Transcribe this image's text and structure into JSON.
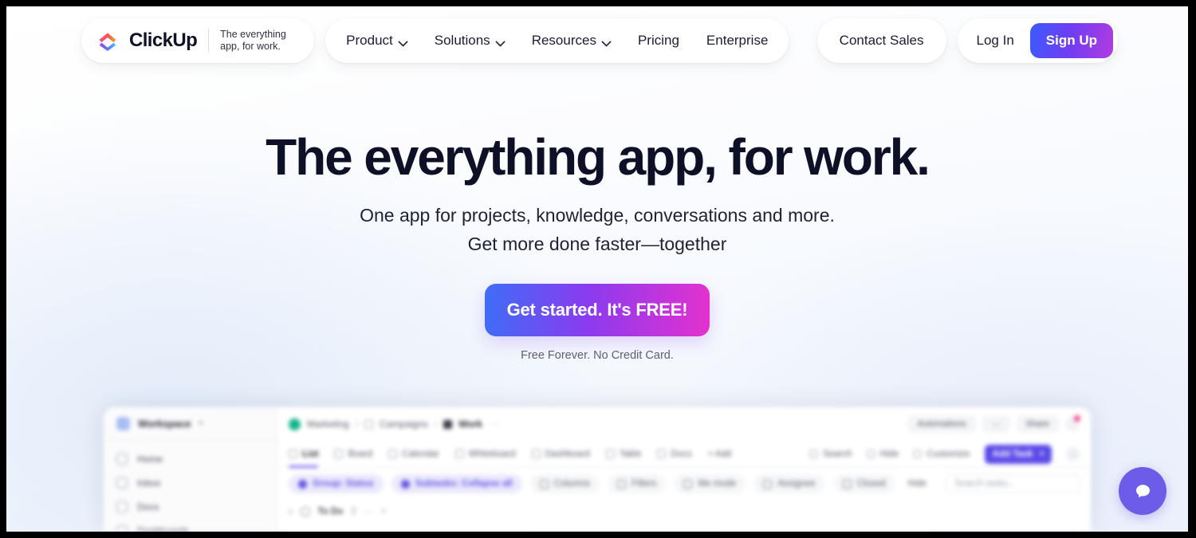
{
  "nav": {
    "logo": {
      "word": "ClickUp",
      "tagline": "The everything app, for work.",
      "icon": "clickup-logo-icon"
    },
    "items": [
      {
        "label": "Product",
        "has_chevron": true
      },
      {
        "label": "Solutions",
        "has_chevron": true
      },
      {
        "label": "Resources",
        "has_chevron": true
      },
      {
        "label": "Pricing",
        "has_chevron": false
      },
      {
        "label": "Enterprise",
        "has_chevron": false
      }
    ],
    "contact_sales": "Contact Sales",
    "log_in": "Log In",
    "sign_up": "Sign Up"
  },
  "hero": {
    "headline": "The everything app, for work.",
    "sub_line1": "One app for projects, knowledge, conversations and more.",
    "sub_line2": "Get more done faster—together",
    "cta_label": "Get started. It's FREE!",
    "cta_note": "Free Forever. No Credit Card."
  },
  "app_preview": {
    "workspace": {
      "name": "Workspace",
      "caret": "▾"
    },
    "sidebar_items": [
      {
        "label": "Home",
        "icon": "home-icon"
      },
      {
        "label": "Inbox",
        "icon": "inbox-icon"
      },
      {
        "label": "Docs",
        "icon": "docs-icon"
      },
      {
        "label": "Dashboards",
        "icon": "dashboards-icon"
      }
    ],
    "breadcrumb": {
      "space": "Marketing",
      "folder": "Campaigns",
      "list": "Work",
      "separator": "/",
      "more": "⋯"
    },
    "header_actions": [
      {
        "label": "Automations"
      },
      {
        "label": "⋯"
      },
      {
        "label": "Share"
      }
    ],
    "views": [
      {
        "label": "List",
        "active": true
      },
      {
        "label": "Board",
        "active": false
      },
      {
        "label": "Calendar",
        "active": false
      },
      {
        "label": "Whiteboard",
        "active": false
      },
      {
        "label": "Dashboard",
        "active": false
      },
      {
        "label": "Table",
        "active": false
      },
      {
        "label": "Docs",
        "active": false
      },
      {
        "label": "+ Add",
        "active": false
      }
    ],
    "view_tools": [
      {
        "label": "Search",
        "icon": "search-icon"
      },
      {
        "label": "Hide",
        "icon": "eye-off-icon"
      },
      {
        "label": "Customize",
        "icon": "sliders-icon"
      }
    ],
    "add_task": {
      "label": "Add Task",
      "caret": "▾"
    },
    "filters": [
      {
        "label": "Group: Status",
        "style": "purple"
      },
      {
        "label": "Subtasks: Collapse all",
        "style": "purple"
      },
      {
        "label": "Columns",
        "style": "plain"
      },
      {
        "label": "Filters",
        "style": "plain"
      },
      {
        "label": "Me mode",
        "style": "plain"
      },
      {
        "label": "Assignee",
        "style": "plain"
      },
      {
        "label": "Closed",
        "style": "plain"
      }
    ],
    "hide_label": "Hide",
    "search_tasks_placeholder": "Search tasks...",
    "group": {
      "name": "To Do",
      "count": "2",
      "more": "⋯",
      "add": "+",
      "caret": "▾"
    }
  },
  "chat": {
    "label": "chat-bubble-icon"
  },
  "colors": {
    "accent_purple": "#7b68ee",
    "cta_gradient_start": "#3e6df6",
    "cta_gradient_mid": "#8b3bef",
    "cta_gradient_end": "#e431cf",
    "headline": "#0e1027",
    "chat_widget": "#6c5ce7",
    "breadcrumb_dot": "#14b48a",
    "notification_dot": "#f4478f"
  }
}
